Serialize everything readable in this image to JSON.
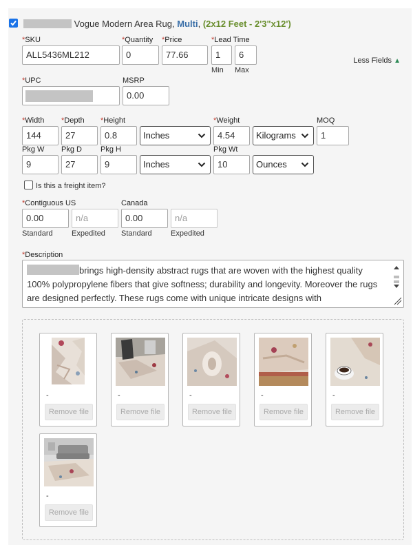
{
  "product": {
    "title_text": "Vogue Modern Area Rug,",
    "color": "Multi",
    "comma": ",",
    "size": "(2x12 Feet - 2'3\"x12')",
    "checked": true
  },
  "fields": {
    "sku": {
      "label": "SKU",
      "value": "ALL5436ML212"
    },
    "quantity": {
      "label": "Quantity",
      "value": "0"
    },
    "price": {
      "label": "Price",
      "value": "77.66"
    },
    "lead_time": {
      "label": "Lead Time",
      "min": "1",
      "max": "6",
      "min_label": "Min",
      "max_label": "Max"
    },
    "less_fields": "Less Fields",
    "upc": {
      "label": "UPC",
      "value": ""
    },
    "msrp": {
      "label": "MSRP",
      "value": "0.00"
    },
    "width": {
      "label": "Width",
      "value": "144"
    },
    "depth": {
      "label": "Depth",
      "value": "27"
    },
    "height": {
      "label": "Height",
      "value": "0.8"
    },
    "dim_unit": "Inches",
    "weight": {
      "label": "Weight",
      "value": "4.54"
    },
    "weight_unit": "Kilograms",
    "moq": {
      "label": "MOQ",
      "value": "1"
    },
    "pkg_w": {
      "label": "Pkg W",
      "value": "9"
    },
    "pkg_d": {
      "label": "Pkg D",
      "value": "27"
    },
    "pkg_h": {
      "label": "Pkg H",
      "value": "9"
    },
    "pkg_dim_unit": "Inches",
    "pkg_wt": {
      "label": "Pkg Wt",
      "value": "10"
    },
    "pkg_wt_unit": "Ounces",
    "freight": {
      "label": "Is this a freight item?",
      "checked": false
    },
    "contiguous_us": {
      "label": "Contiguous US",
      "standard": "0.00",
      "expedited_placeholder": "n/a",
      "standard_label": "Standard",
      "expedited_label": "Expedited"
    },
    "canada": {
      "label": "Canada",
      "standard": "0.00",
      "expedited_placeholder": "n/a",
      "standard_label": "Standard",
      "expedited_label": "Expedited"
    },
    "description": {
      "label": "Description",
      "text": "brings high-density abstract rugs that are woven with the highest quality 100% polypropylene fibers that give softness; durability and longevity. Moreover the rugs are designed perfectly. These rugs come with unique intricate designs with"
    }
  },
  "images": [
    {
      "caption": "-",
      "remove_label": "Remove file",
      "kind": "rug-upright"
    },
    {
      "caption": "-",
      "remove_label": "Remove file",
      "kind": "room-chair"
    },
    {
      "caption": "-",
      "remove_label": "Remove file",
      "kind": "rug-rolled"
    },
    {
      "caption": "-",
      "remove_label": "Remove file",
      "kind": "rug-closeup-floor"
    },
    {
      "caption": "-",
      "remove_label": "Remove file",
      "kind": "rug-coffee"
    },
    {
      "caption": "-",
      "remove_label": "Remove file",
      "kind": "room-sofa"
    }
  ],
  "colors": {
    "required": "#c0392b",
    "color_link": "#3a6fa8",
    "size_text": "#6a8f2f",
    "checkbox": "#1a73e8"
  }
}
